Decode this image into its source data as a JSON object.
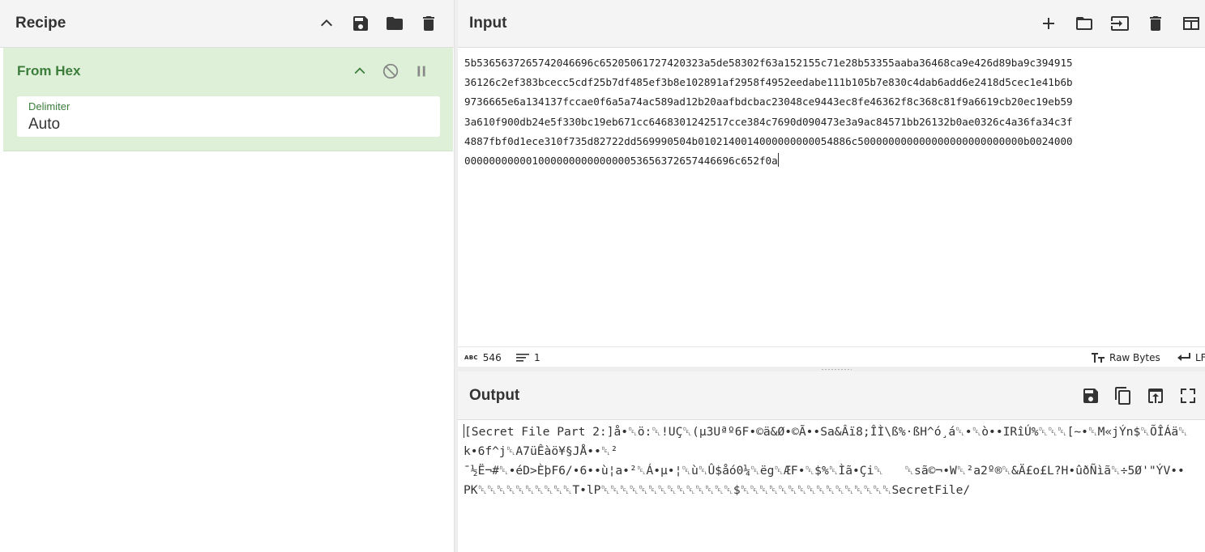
{
  "recipe": {
    "title": "Recipe",
    "icons": [
      "chevron-up-icon",
      "save-icon",
      "folder-icon",
      "trash-icon"
    ],
    "operation": {
      "name": "From Hex",
      "icons": [
        "chevron-up-icon",
        "disable-icon",
        "pause-icon"
      ],
      "arg_label": "Delimiter",
      "arg_value": "Auto"
    }
  },
  "input": {
    "title": "Input",
    "icons": [
      "plus-icon",
      "folder-icon",
      "import-icon",
      "trash-icon",
      "layout-icon"
    ],
    "lines": [
      "5b5365637265742046696c65205061727420323a5de58302f63a152155c71e28b53355aaba36468ca9e426d89ba9c394915",
      "36126c2ef383bcecc5cdf25b7df485ef3b8e102891af2958f4952eedabe111b105b7e830c4dab6add6e2418d5cec1e41b6b",
      "9736665e6a134137fccae0f6a5a74ac589ad12b20aafbdcbac23048ce9443ec8fe46362f8c368c81f9a6619cb20ec19eb59",
      "3a610f900db24e5f330bc19eb671cc6468301242517cce384c7690d090473e3a9ac84571bb26132b0ae0326c4a36fa34c3f",
      "4887fbf0d1ece310f735d82722dd569990504b0102140014000000000054886c500000000000000000000000000b0024000",
      "00000000000100000000000000053656372657446696c652f0a"
    ],
    "status": {
      "length": "546",
      "lines": "1",
      "encoding": "Raw Bytes",
      "eol": "LF"
    }
  },
  "output": {
    "title": "Output",
    "icons": [
      "save-icon",
      "copy-icon",
      "replace-input-icon",
      "maximise-icon"
    ],
    "lines": [
      "[Secret File Part 2:]å•␡ö:␡!UÇ␡(µ3Uªº6F•©ä&Ø•©Ã••Sa&Âï8;ÎÌ\\ß%·ßH^ó¸á␡•␡ò••IRîÚ%␡␡␡[~•␡M«jÝn$␡ÕÎÁä␡",
      "k•6f^j␡A7üÊàö¥§JÅ••␡²",
      "¯½Ë¬#␡•éD>ÈþF6/•6••ù¦a•²␡Á•µ•¦␡ù␡Û$åó0¼␡ëg␡ÆF•␡$%␡Ìã•Çi␡   ␡sã©¬•W␡²a2º®␡&Ä£o£L?H•ûðÑìã␡÷5Ø'\"ÝV••",
      "PK␡␡␡␡␡␡␡␡␡␡T•lP␡␡␡␡␡␡␡␡␡␡␡␡␡␡$␡␡␡␡␡␡␡␡␡␡␡␡␡␡␡␡SecretFile/"
    ]
  }
}
